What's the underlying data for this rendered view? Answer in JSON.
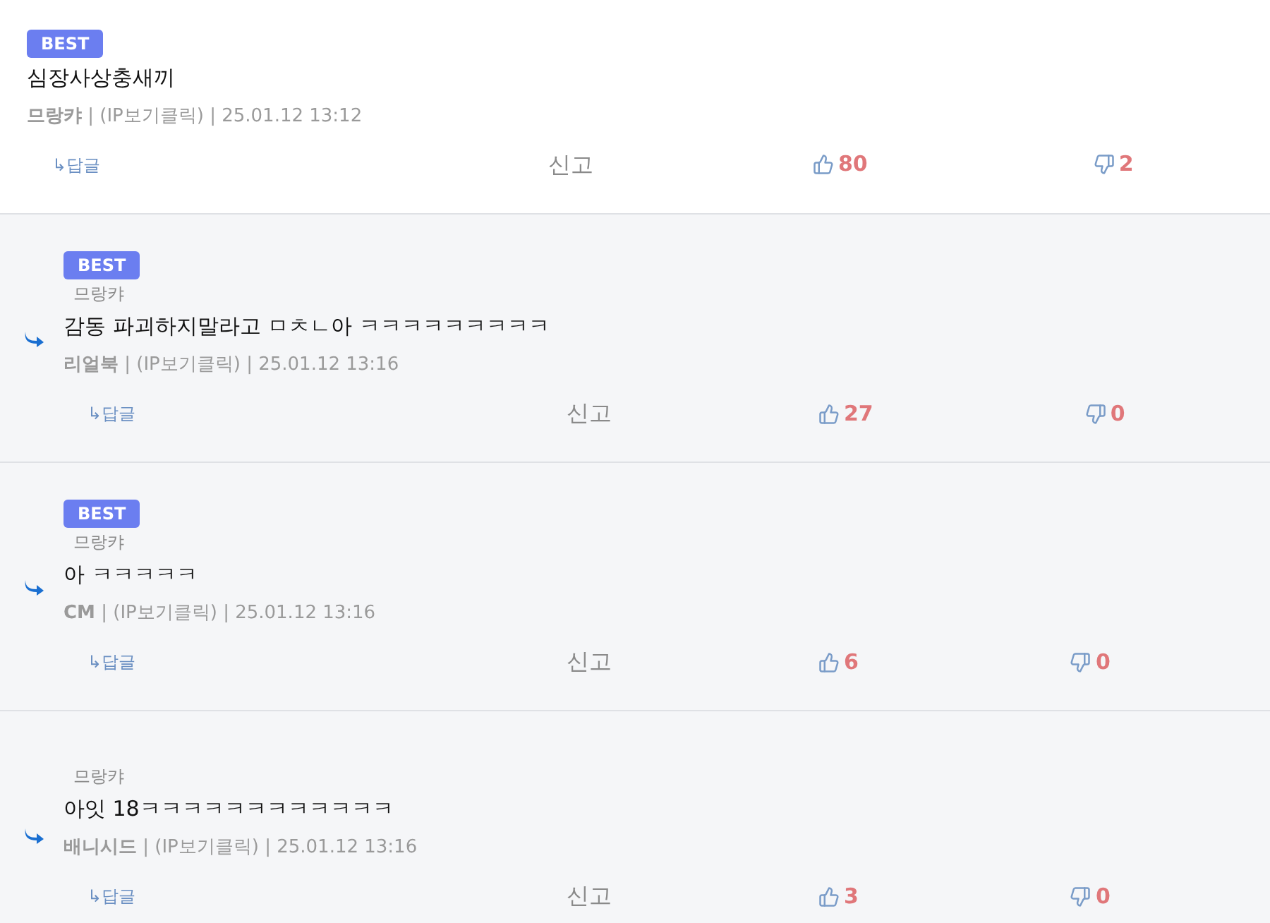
{
  "comments": [
    {
      "kind": "comment",
      "badge": "BEST",
      "text": "심장사상충새끼",
      "meta": "**므랑캬** | (IP보기클릭) | 25.01.12 13:12",
      "reply_label": "↳답글",
      "report": "신고",
      "likes": "80",
      "dislikes": "2"
    },
    {
      "kind": "reply",
      "badge": "BEST",
      "mention": "므랑캬",
      "text": "감동 파괴하지말라고 ㅁㅊㄴ아 ㅋㅋㅋㅋㅋㅋㅋㅋㅋ",
      "meta": "**리얼북** | (IP보기클릭) | 25.01.12 13:16",
      "reply_label": "↳답글",
      "report": "신고",
      "likes": "27",
      "dislikes": "0"
    },
    {
      "kind": "reply",
      "badge": "BEST",
      "mention": "므랑캬",
      "text": "아 ㅋㅋㅋㅋㅋ",
      "meta": "**CM** | (IP보기클릭) | 25.01.12 13:16",
      "reply_label": "↳답글",
      "report": "신고",
      "likes": "6",
      "dislikes": "0"
    },
    {
      "kind": "reply",
      "mention": "므랑캬",
      "text": "아잇 18ㅋㅋㅋㅋㅋㅋㅋㅋㅋㅋㅋㅋ",
      "meta": "**배니시드** | (IP보기클릭) | 25.01.12 13:16",
      "reply_label": "↳답글",
      "report": "신고",
      "likes": "3",
      "dislikes": "0"
    }
  ]
}
